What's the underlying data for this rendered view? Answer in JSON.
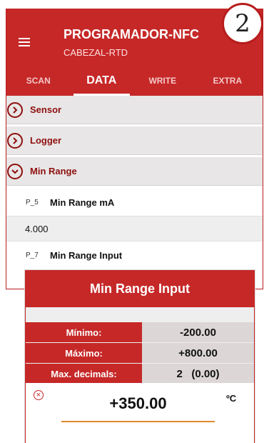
{
  "badge": {
    "number": "2"
  },
  "app": {
    "title": "PROGRAMADOR-NFC",
    "subtitle": "CABEZAL-RTD",
    "accent_color": "#c62828"
  },
  "tabs": [
    {
      "label": "SCAN",
      "active": false
    },
    {
      "label": "DATA",
      "active": true
    },
    {
      "label": "WRITE",
      "active": false
    },
    {
      "label": "EXTRA",
      "active": false
    }
  ],
  "sections": [
    {
      "label": "Sensor",
      "expanded": false,
      "icon": "chevron-right-icon"
    },
    {
      "label": "Logger",
      "expanded": false,
      "icon": "chevron-right-icon"
    },
    {
      "label": "Min Range",
      "expanded": true,
      "icon": "chevron-down-icon"
    }
  ],
  "params": [
    {
      "code": "P_5",
      "label": "Min Range mA",
      "value": "4.000"
    },
    {
      "code": "P_7",
      "label": "Min Range Input"
    }
  ],
  "dialog": {
    "title": "Min Range Input",
    "rows": [
      {
        "label": "Mínimo:",
        "value": "-200.00"
      },
      {
        "label": "Máximo:",
        "value": "+800.00"
      },
      {
        "label": "Max. decimals:",
        "value": "2   (0.00)"
      }
    ],
    "input": {
      "value": "+350.00",
      "unit": "ºC",
      "clear_icon": "clear-icon"
    }
  }
}
